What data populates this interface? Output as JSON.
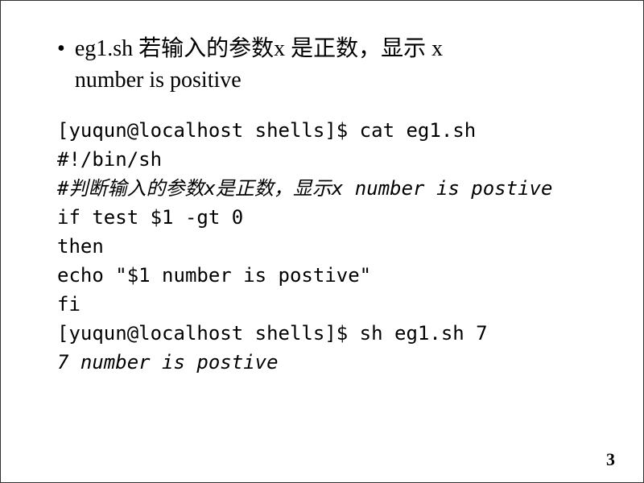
{
  "bullet": {
    "marker": "•",
    "text_line1": "eg1.sh 若输入的参数x 是正数，显示 x",
    "text_line2": "number is positive"
  },
  "terminal": {
    "line1": "[yuqun@localhost shells]$ cat eg1.sh",
    "line2": "#!/bin/sh",
    "line3": "#判断输入的参数x是正数，显示x number is postive",
    "line4": "if test $1 -gt 0",
    "line5": "then",
    "line6": "echo \"$1 number is postive\"",
    "line7": "fi",
    "line8": "[yuqun@localhost shells]$ sh eg1.sh 7",
    "line9": "7 number is postive"
  },
  "page_number": "3"
}
